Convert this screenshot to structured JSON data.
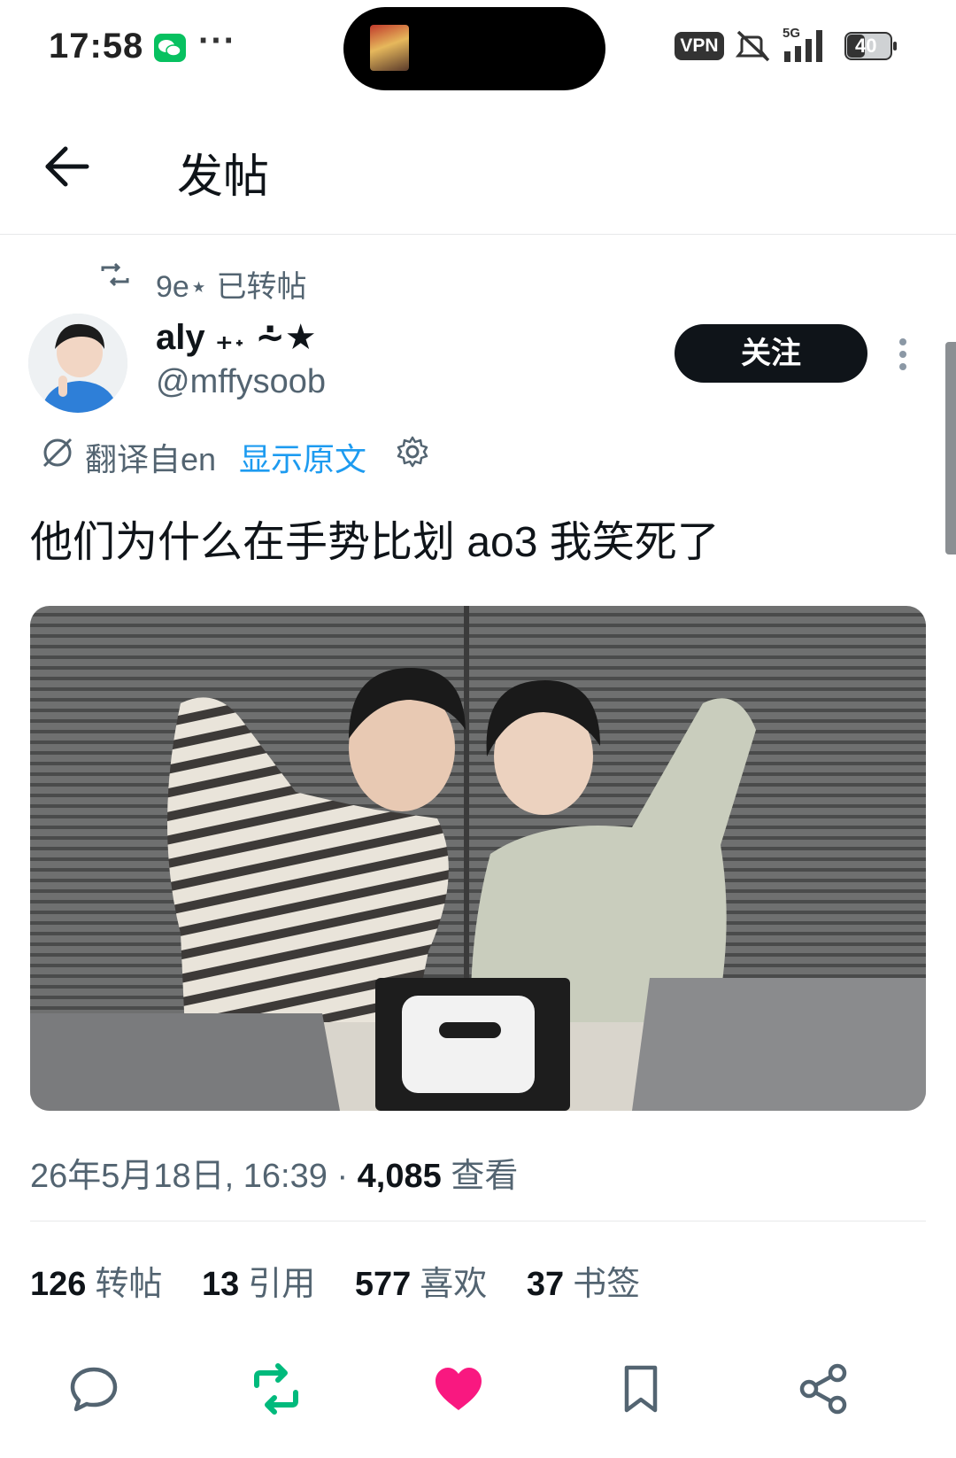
{
  "status_bar": {
    "time": "17:58",
    "more": "···",
    "vpn": "VPN",
    "network": "5G",
    "battery": "40"
  },
  "header": {
    "title": "发帖"
  },
  "retweet_context": {
    "label": "9e⋆ 已转帖"
  },
  "author": {
    "display_name": "aly ₊˖ ⩪★",
    "handle": "@mffysoob",
    "follow_label": "关注"
  },
  "translation": {
    "from": "翻译自en",
    "show_original": "显示原文"
  },
  "tweet": {
    "text": "他们为什么在手势比划 ao3 我笑死了",
    "timestamp": "26年5月18日, 16:39",
    "separator": " · ",
    "views": "4,085",
    "views_label": " 查看"
  },
  "stats": [
    {
      "count": "126",
      "label": "转帖"
    },
    {
      "count": "13",
      "label": "引用"
    },
    {
      "count": "577",
      "label": "喜欢"
    },
    {
      "count": "37",
      "label": "书签"
    }
  ],
  "actions": {
    "icons": [
      "reply-icon",
      "retweet-icon",
      "like-icon",
      "bookmark-icon",
      "share-icon"
    ],
    "retweeted": true,
    "liked": true
  },
  "colors": {
    "accent": "#1d9bf0",
    "retweet_green": "#00ba7c",
    "like_pink": "#f91880",
    "text": "#0f1419",
    "secondary": "#536471"
  }
}
